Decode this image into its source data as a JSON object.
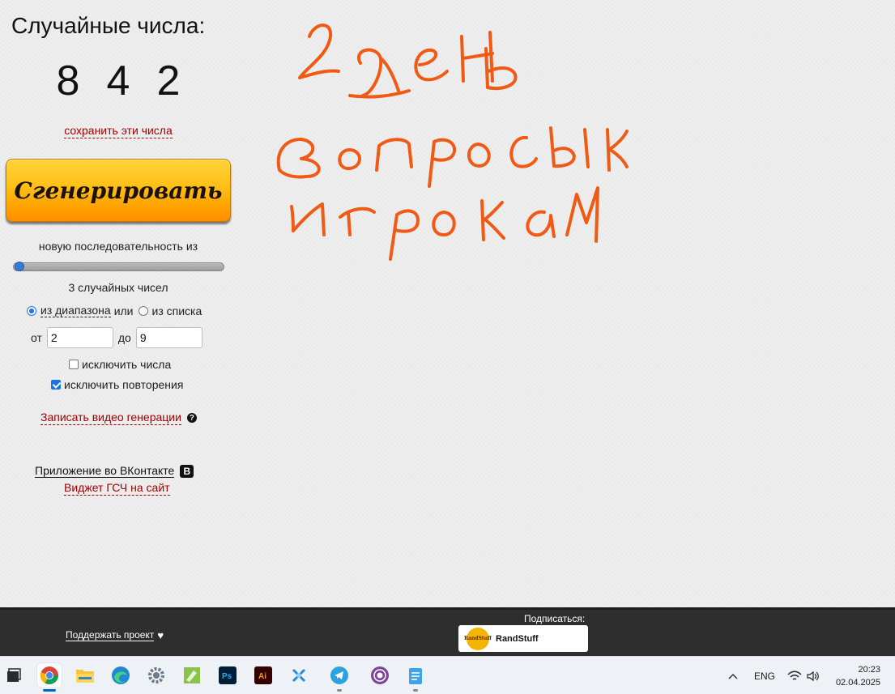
{
  "generator": {
    "title": "Случайные числа:",
    "numbers": [
      "8",
      "4",
      "2"
    ],
    "save_link": "сохранить эти числа",
    "generate_button": "Сгенерировать",
    "sequence_label": "новую последовательность из",
    "count_fraction": 0.0,
    "count_label": "3 случайных чисел",
    "mode": {
      "range_label": "из диапазона",
      "or_text": "или",
      "list_label": "из списка",
      "selected": "range"
    },
    "range": {
      "from_label": "от",
      "from_value": "2",
      "to_label": "до",
      "to_value": "9"
    },
    "exclude_numbers": {
      "label": "исключить числа",
      "checked": false
    },
    "exclude_repeats": {
      "label": "исключить повторения",
      "checked": true
    },
    "record_video": "Записать видео генерации",
    "vk_app": "Приложение во ВКонтакте",
    "widget": "Виджет ГСЧ на сайт"
  },
  "handwriting": {
    "color": "#f05a14",
    "lines": [
      "2 день",
      "вопросы к",
      "игрокам"
    ]
  },
  "footer": {
    "support": "Поддержать проект",
    "subscribe_label": "Подписаться:",
    "channel_name": "RandStuff",
    "channel_logo_text": "RandStuff"
  },
  "taskbar": {
    "apps": [
      "windows-start-icon",
      "chrome-icon",
      "file-explorer-icon",
      "edge-icon",
      "settings-icon",
      "notepad-plus-icon",
      "photoshop-icon",
      "illustrator-icon",
      "app-x-icon",
      "telegram-icon",
      "tor-browser-icon",
      "notepad-icon"
    ],
    "photoshop_label": "Ps",
    "illustrator_label": "Ai",
    "language": "ENG",
    "time": "20:23",
    "date": "02.04.2025"
  },
  "colors": {
    "button_gradient_top": "#ffd23a",
    "button_gradient_bottom": "#ff8c00",
    "link_red": "#a00000",
    "footer_bg": "#2e2e2e"
  }
}
